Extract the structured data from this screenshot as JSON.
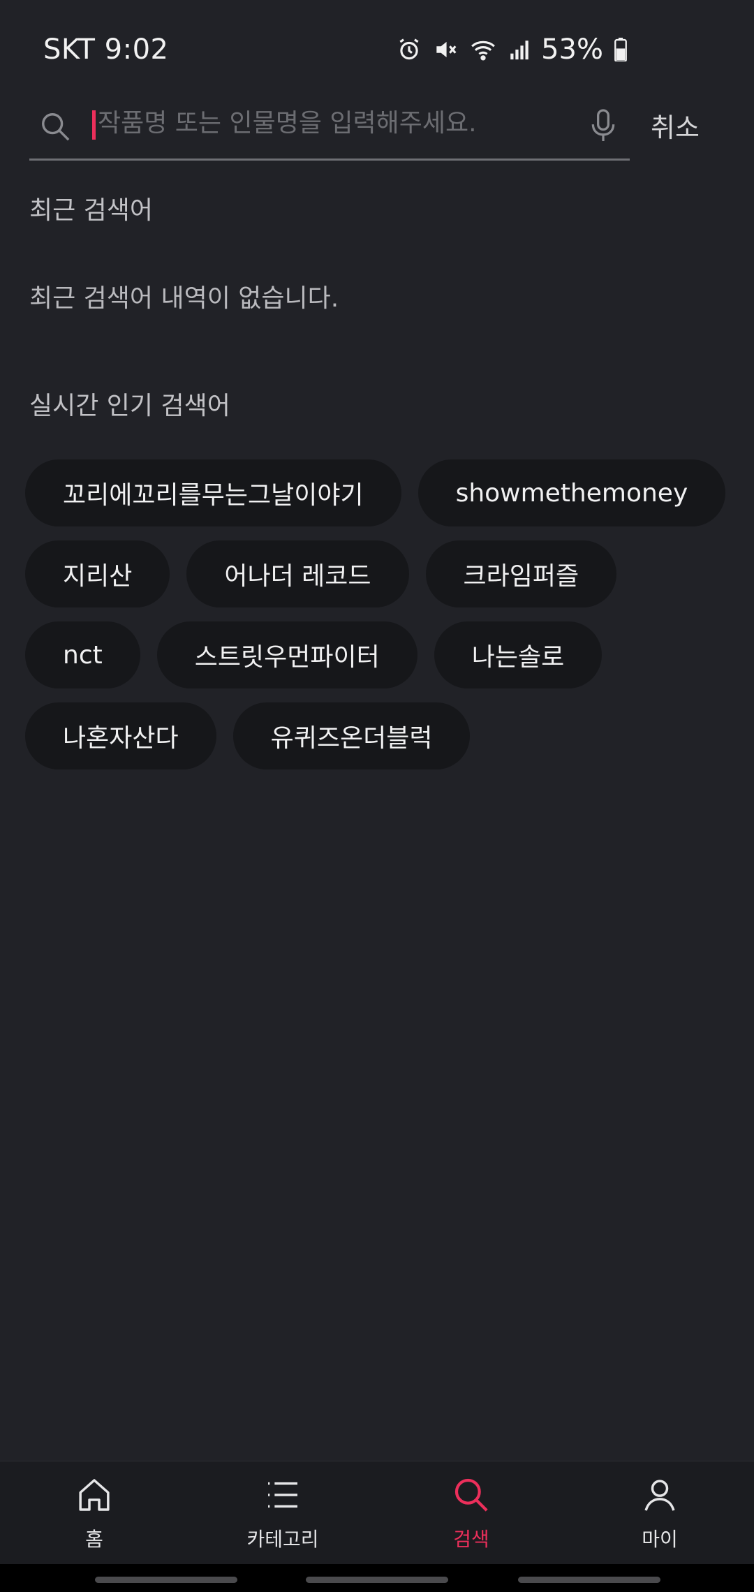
{
  "status_bar": {
    "carrier_time": "SKT 9:02",
    "battery": "53%"
  },
  "search": {
    "placeholder": "작품명 또는 인물명을 입력해주세요.",
    "value": "",
    "cancel_label": "취소"
  },
  "recent": {
    "title": "최근 검색어",
    "empty_message": "최근 검색어 내역이 없습니다."
  },
  "popular": {
    "title": "실시간 인기 검색어",
    "items": [
      "꼬리에꼬리를무는그날이야기",
      "showmethemoney",
      "지리산",
      "어나더 레코드",
      "크라임퍼즐",
      "nct",
      "스트릿우먼파이터",
      "나는솔로",
      "나혼자산다",
      "유퀴즈온더블럭"
    ]
  },
  "bottom_nav": {
    "items": [
      {
        "label": "홈",
        "icon": "home-icon"
      },
      {
        "label": "카테고리",
        "icon": "list-icon"
      },
      {
        "label": "검색",
        "icon": "search-icon",
        "active": true
      },
      {
        "label": "마이",
        "icon": "person-icon"
      }
    ]
  },
  "colors": {
    "background": "#212227",
    "chip": "#16171a",
    "accent": "#ec2f5b"
  }
}
